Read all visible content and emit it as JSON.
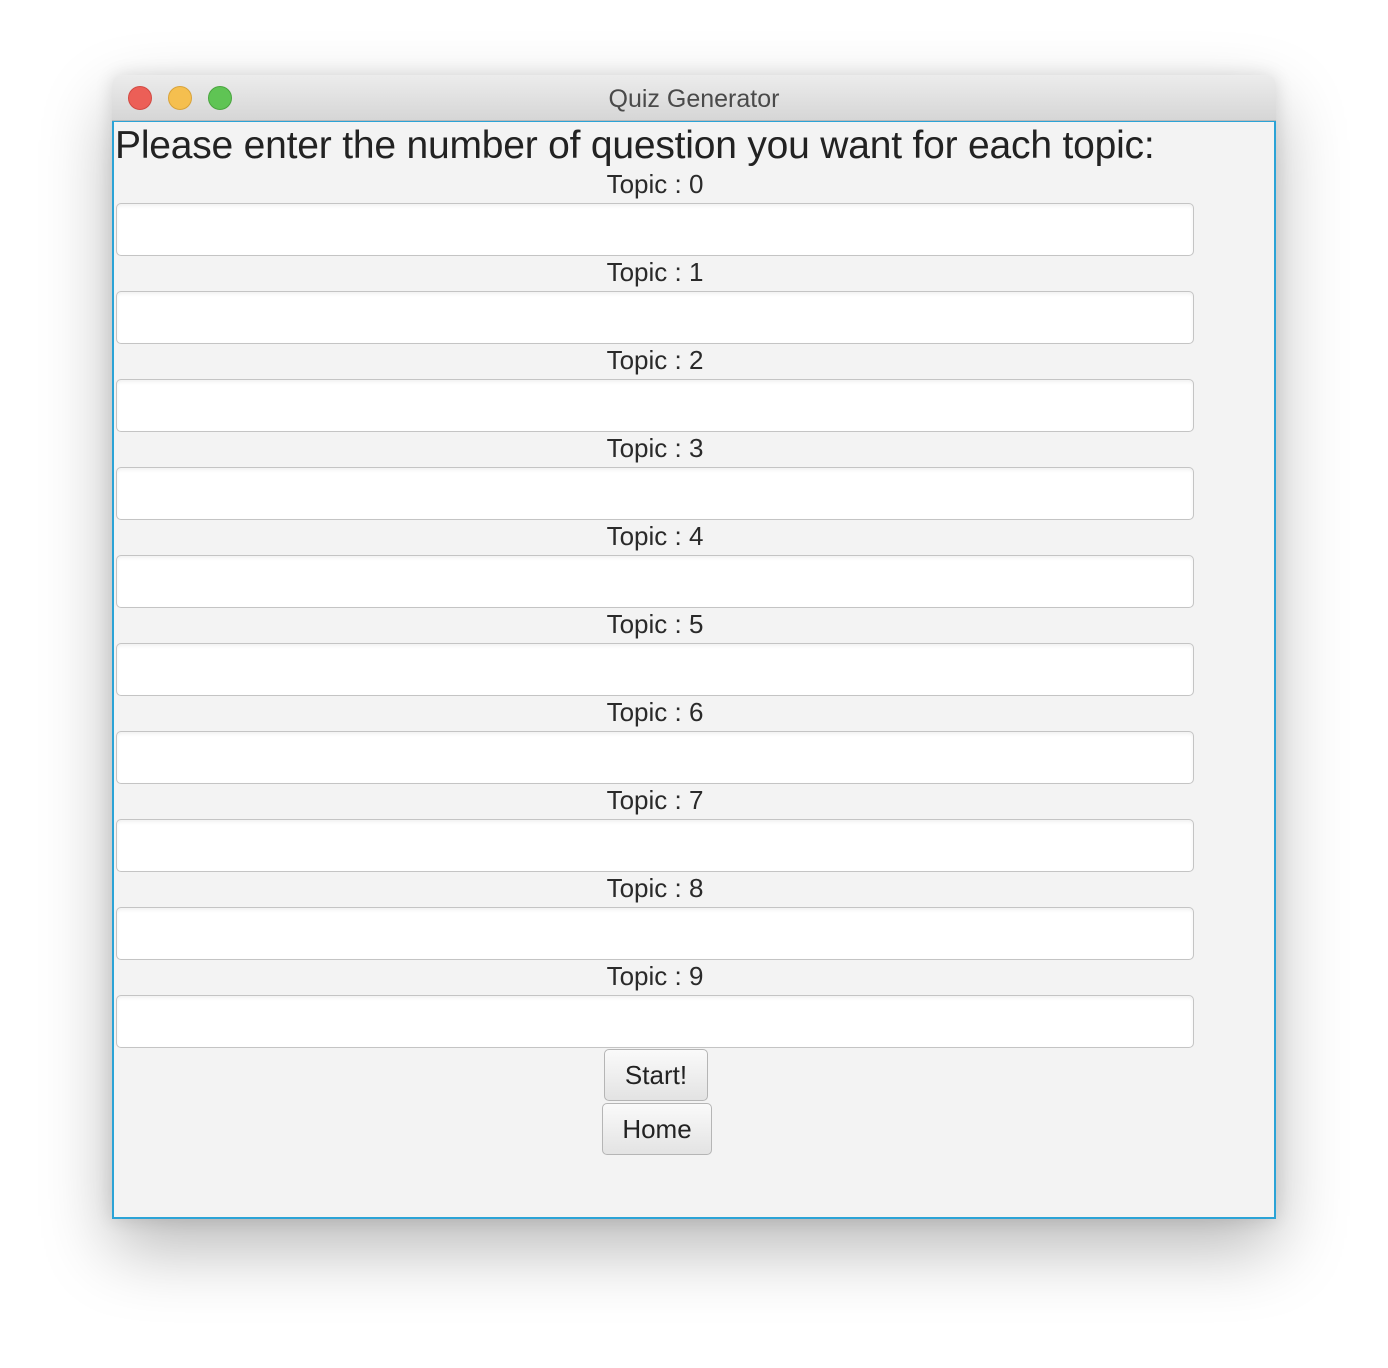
{
  "window": {
    "title": "Quiz Generator"
  },
  "main": {
    "heading": "Please enter the number of question you want for each topic:",
    "topics": [
      {
        "label": "Topic : 0",
        "value": ""
      },
      {
        "label": "Topic : 1",
        "value": ""
      },
      {
        "label": "Topic : 2",
        "value": ""
      },
      {
        "label": "Topic : 3",
        "value": ""
      },
      {
        "label": "Topic : 4",
        "value": ""
      },
      {
        "label": "Topic : 5",
        "value": ""
      },
      {
        "label": "Topic : 6",
        "value": ""
      },
      {
        "label": "Topic : 7",
        "value": ""
      },
      {
        "label": "Topic : 8",
        "value": ""
      },
      {
        "label": "Topic : 9",
        "value": ""
      }
    ],
    "start_label": "Start!",
    "home_label": "Home"
  },
  "colors": {
    "close": "#ec5f57",
    "minimize": "#f5bf4f",
    "maximize": "#5fc454",
    "focus_border": "#2ba3d6"
  }
}
